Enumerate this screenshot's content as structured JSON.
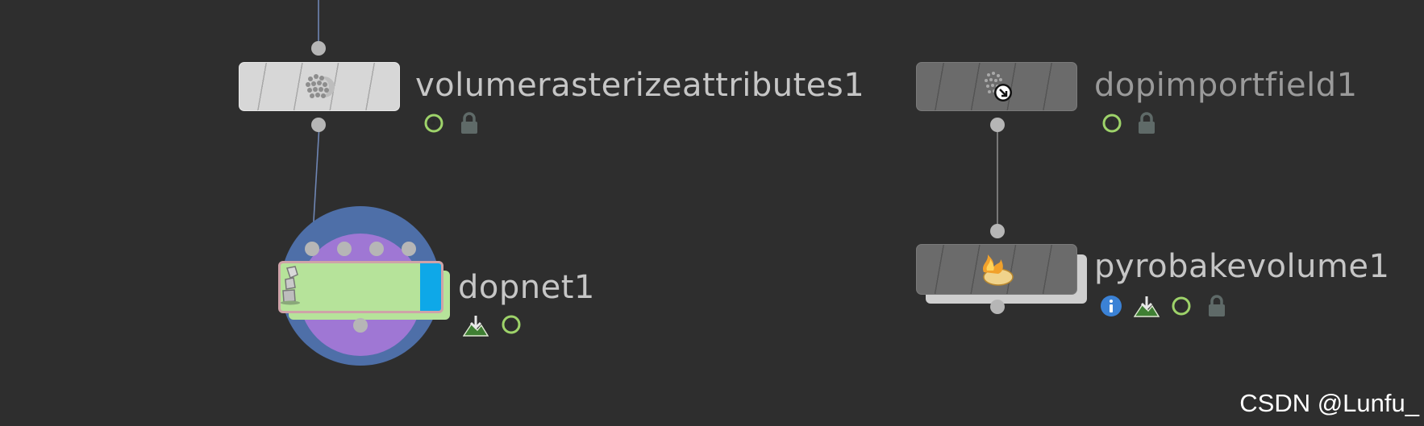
{
  "nodes": {
    "volumerasterize": {
      "name": "volumerasterizeattributes1",
      "icon": "volume-rasterize-icon"
    },
    "dopimportfield": {
      "name": "dopimportfield1",
      "icon": "dop-import-field-icon"
    },
    "dopnet": {
      "name": "dopnet1",
      "icon": "dop-network-icon"
    },
    "pyrobake": {
      "name": "pyrobakevolume1",
      "icon": "pyro-bake-icon"
    }
  },
  "watermark": "CSDN @Lunfu_",
  "colors": {
    "background": "#2e2e2e",
    "node_light": "#d7d7d7",
    "node_dark": "#6b6b6b",
    "dopnet_body": "#b6e39a",
    "dopnet_accent": "#0ea8e8",
    "wire": "#7a8fb8",
    "flag_green": "#9ed36a",
    "info_blue": "#3b82d6"
  }
}
